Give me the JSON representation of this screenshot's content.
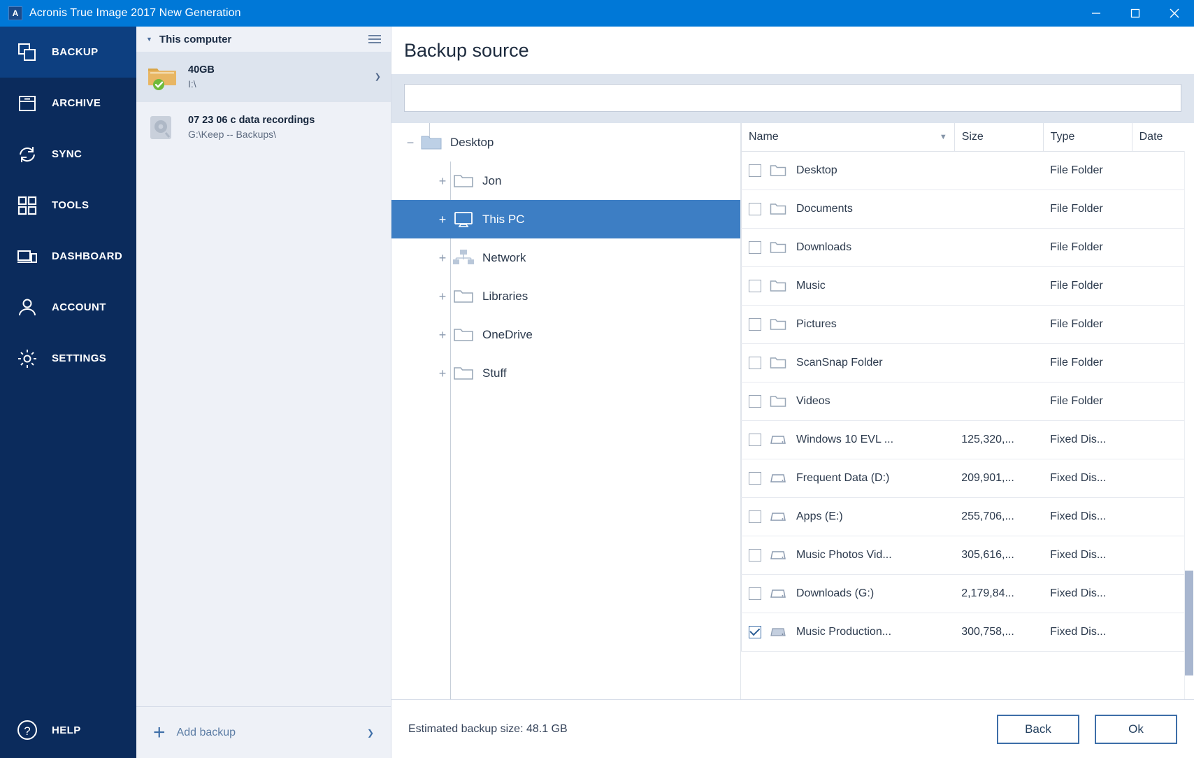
{
  "window": {
    "title": "Acronis True Image 2017 New Generation",
    "app_badge": "A",
    "controls": {
      "minimize": "minimize-icon",
      "maximize": "maximize-icon",
      "close": "close-icon"
    },
    "accent": "#0078d7"
  },
  "sidebar": {
    "background": "#0b2b5c",
    "active_background": "#0d3f80",
    "items": [
      {
        "label": "BACKUP",
        "icon": "backup-copies-icon",
        "active": true
      },
      {
        "label": "ARCHIVE",
        "icon": "archive-box-icon",
        "active": false
      },
      {
        "label": "SYNC",
        "icon": "sync-arrows-icon",
        "active": false
      },
      {
        "label": "TOOLS",
        "icon": "grid-squares-icon",
        "active": false
      },
      {
        "label": "DASHBOARD",
        "icon": "devices-icon",
        "active": false
      },
      {
        "label": "ACCOUNT",
        "icon": "person-icon",
        "active": false
      },
      {
        "label": "SETTINGS",
        "icon": "gear-icon",
        "active": false
      }
    ],
    "help": {
      "label": "HELP",
      "icon": "question-circle-icon"
    }
  },
  "backups_panel": {
    "header_title": "This computer",
    "header_caret": "caret-down-icon",
    "menu_icon": "hamburger-icon",
    "items": [
      {
        "name": "40GB",
        "path": "I:\\",
        "icon": "folder-amber-icon",
        "status_icon": "green-check-icon",
        "selected": true,
        "caret": "chevron-down-icon"
      },
      {
        "name": "07 23 06 c data recordings",
        "path": "G:\\Keep -- Backups\\",
        "icon": "hard-disk-icon",
        "status_icon": "",
        "selected": false,
        "caret": ""
      }
    ],
    "add_backup": {
      "label": "Add backup",
      "plus": "plus-icon",
      "caret": "chevron-down-icon"
    }
  },
  "main": {
    "title": "Backup source",
    "search": {
      "value": "",
      "placeholder": ""
    }
  },
  "tree": {
    "nodes": [
      {
        "label": "Desktop",
        "depth": 0,
        "expander": "minus",
        "icon": "folder-blue-filled-icon",
        "selected": false
      },
      {
        "label": "Jon",
        "depth": 1,
        "expander": "plus",
        "icon": "folder-outline-icon",
        "selected": false
      },
      {
        "label": "This PC",
        "depth": 1,
        "expander": "plus",
        "icon": "monitor-icon",
        "selected": true
      },
      {
        "label": "Network",
        "depth": 1,
        "expander": "plus",
        "icon": "network-icon",
        "selected": false
      },
      {
        "label": "Libraries",
        "depth": 1,
        "expander": "plus",
        "icon": "folder-outline-icon",
        "selected": false
      },
      {
        "label": "OneDrive",
        "depth": 1,
        "expander": "plus",
        "icon": "folder-outline-icon",
        "selected": false
      },
      {
        "label": "Stuff",
        "depth": 1,
        "expander": "plus",
        "icon": "folder-outline-icon",
        "selected": false
      }
    ]
  },
  "filelist": {
    "columns": [
      "Name",
      "Size",
      "Type",
      "Date"
    ],
    "sort_caret": "chevron-down-icon",
    "rows": [
      {
        "checked": false,
        "icon": "folder-outline-icon",
        "name": "Desktop",
        "size": "",
        "type": "File Folder",
        "date": ""
      },
      {
        "checked": false,
        "icon": "folder-outline-icon",
        "name": "Documents",
        "size": "",
        "type": "File Folder",
        "date": ""
      },
      {
        "checked": false,
        "icon": "folder-outline-icon",
        "name": "Downloads",
        "size": "",
        "type": "File Folder",
        "date": ""
      },
      {
        "checked": false,
        "icon": "folder-outline-icon",
        "name": "Music",
        "size": "",
        "type": "File Folder",
        "date": ""
      },
      {
        "checked": false,
        "icon": "folder-outline-icon",
        "name": "Pictures",
        "size": "",
        "type": "File Folder",
        "date": ""
      },
      {
        "checked": false,
        "icon": "folder-outline-icon",
        "name": "ScanSnap Folder",
        "size": "",
        "type": "File Folder",
        "date": ""
      },
      {
        "checked": false,
        "icon": "folder-outline-icon",
        "name": "Videos",
        "size": "",
        "type": "File Folder",
        "date": ""
      },
      {
        "checked": false,
        "icon": "disk-icon",
        "name": "Windows 10 EVL ...",
        "size": "125,320,...",
        "type": "Fixed Dis...",
        "date": ""
      },
      {
        "checked": false,
        "icon": "disk-icon",
        "name": "Frequent Data (D:)",
        "size": "209,901,...",
        "type": "Fixed Dis...",
        "date": ""
      },
      {
        "checked": false,
        "icon": "disk-icon",
        "name": "Apps (E:)",
        "size": "255,706,...",
        "type": "Fixed Dis...",
        "date": ""
      },
      {
        "checked": false,
        "icon": "disk-icon",
        "name": "Music Photos Vid...",
        "size": "305,616,...",
        "type": "Fixed Dis...",
        "date": ""
      },
      {
        "checked": false,
        "icon": "disk-icon",
        "name": "Downloads (G:)",
        "size": "2,179,84...",
        "type": "Fixed Dis...",
        "date": ""
      },
      {
        "checked": true,
        "icon": "disk-icon",
        "name": "Music Production...",
        "size": "300,758,...",
        "type": "Fixed Dis...",
        "date": ""
      }
    ]
  },
  "footer": {
    "estimate": "Estimated backup size: 48.1 GB",
    "back_label": "Back",
    "ok_label": "Ok"
  }
}
